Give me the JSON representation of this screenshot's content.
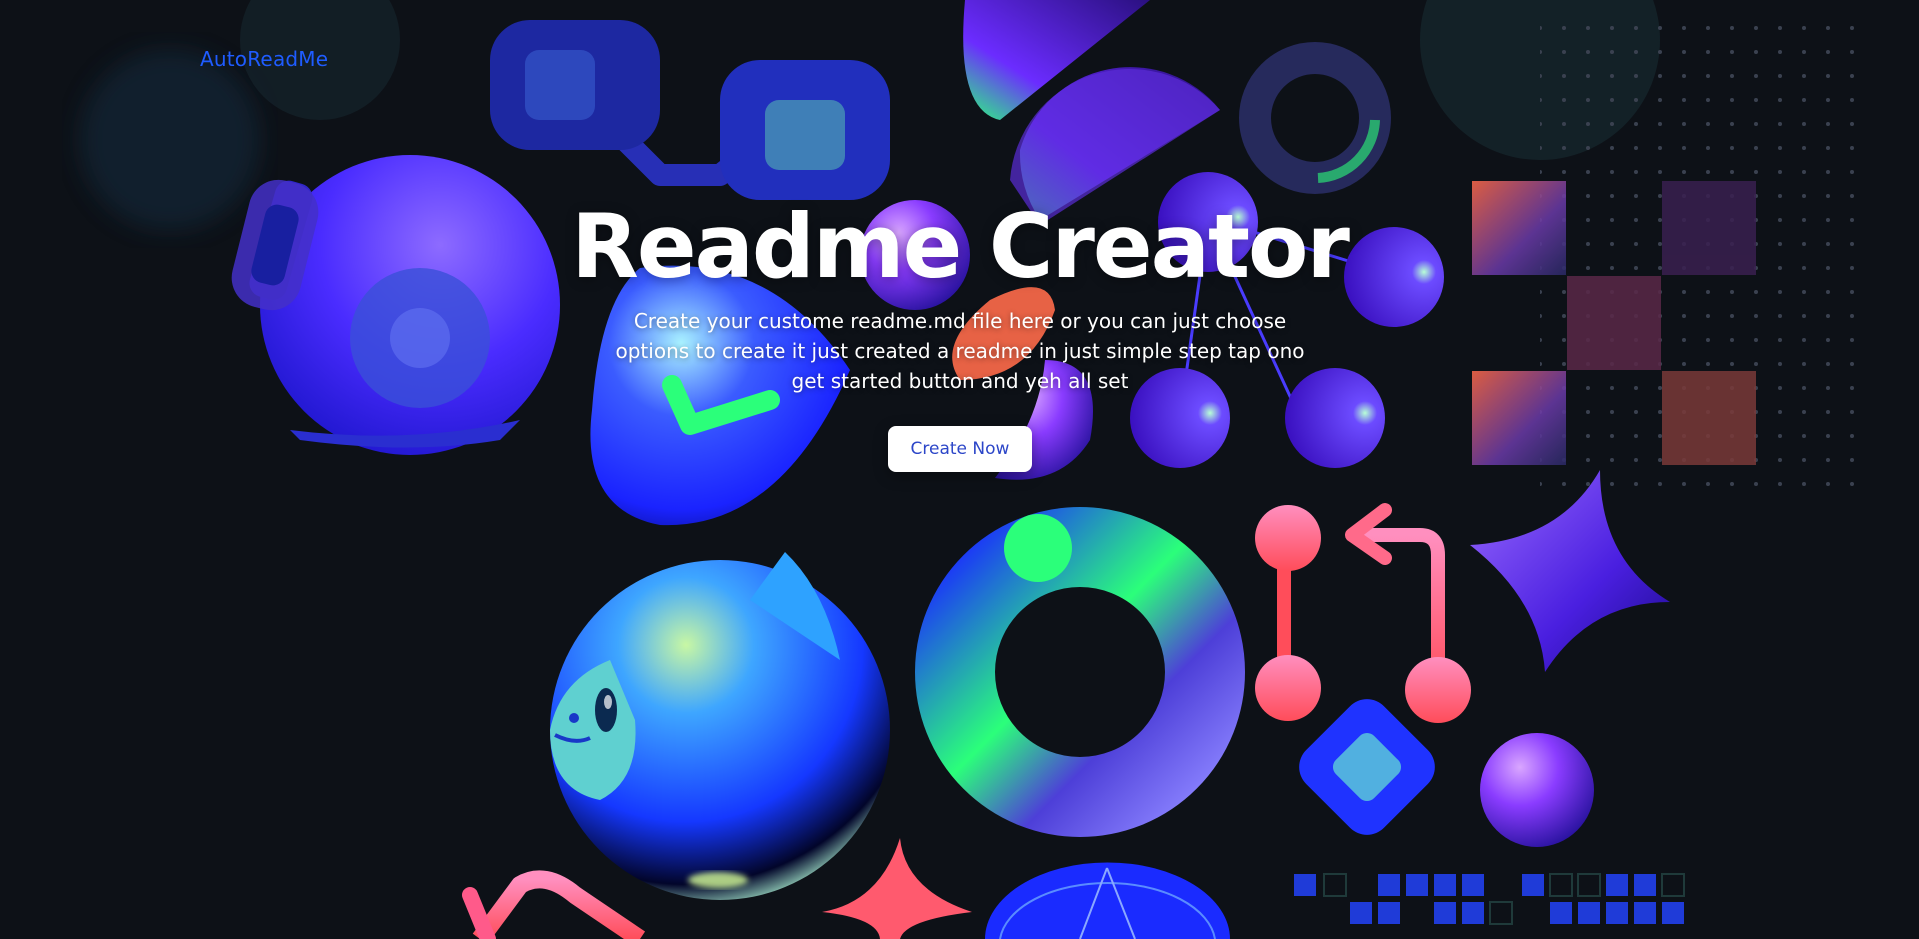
{
  "header": {
    "brand": "AutoReadMe"
  },
  "hero": {
    "title": "Readme Creator",
    "subtitle": "Create your custome readme.md file here or you can just choose options to create it just created a readme in just simple step tap ono get started button and yeh all set",
    "cta_label": "Create Now"
  },
  "theme": {
    "background": "#0d1117",
    "brand_color": "#1f5cff",
    "cta_text_color": "#2c46c8",
    "accent_blue": "#1a2bff",
    "accent_purple": "#8a3cff",
    "accent_green": "#2bff7a",
    "accent_coral": "#ff5a6e"
  },
  "decorations": [
    "astronaut-helmet-icon",
    "clock-icon",
    "branch-flow-icon",
    "half-circle-icon",
    "ring-icon",
    "node-network-icon",
    "checkerboard-icon",
    "dot-grid-pattern",
    "pig-mascot-icon",
    "donut-icon",
    "pull-request-icon",
    "diamond-icon",
    "star-sparkle-icon",
    "sphere-icon",
    "pixel-grid-pattern",
    "return-arrow-icon",
    "radar-dome-icon"
  ]
}
